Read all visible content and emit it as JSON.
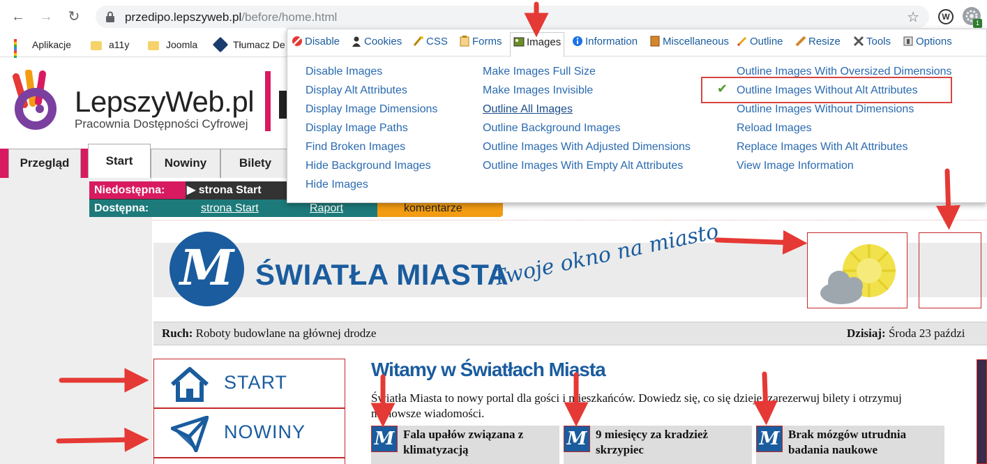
{
  "browser": {
    "url_host": "przedipo.lepszyweb.pl",
    "url_path": "/before/home.html",
    "extension_badge": "1",
    "extension_letter": "W"
  },
  "bookmarks": [
    {
      "label": "Aplikacje",
      "icon": "apps-grid-icon"
    },
    {
      "label": "a11y",
      "icon": "folder-icon"
    },
    {
      "label": "Joomla",
      "icon": "folder-icon"
    },
    {
      "label": "Tłumacz De",
      "icon": "translator-icon"
    }
  ],
  "webdev": {
    "tabs": [
      {
        "label": "Disable",
        "icon": "disable-icon"
      },
      {
        "label": "Cookies",
        "icon": "cookies-icon"
      },
      {
        "label": "CSS",
        "icon": "css-icon"
      },
      {
        "label": "Forms",
        "icon": "forms-icon"
      },
      {
        "label": "Images",
        "icon": "images-icon",
        "active": true
      },
      {
        "label": "Information",
        "icon": "information-icon"
      },
      {
        "label": "Miscellaneous",
        "icon": "miscellaneous-icon"
      },
      {
        "label": "Outline",
        "icon": "outline-icon"
      },
      {
        "label": "Resize",
        "icon": "resize-icon"
      },
      {
        "label": "Tools",
        "icon": "tools-icon"
      },
      {
        "label": "Options",
        "icon": "options-icon"
      }
    ],
    "col1": [
      "Disable Images",
      "Display Alt Attributes",
      "Display Image Dimensions",
      "Display Image Paths",
      "Find Broken Images",
      "Hide Background Images",
      "Hide Images"
    ],
    "col2": [
      "Make Images Full Size",
      "Make Images Invisible",
      "Outline All Images",
      "Outline Background Images",
      "Outline Images With Adjusted Dimensions",
      "Outline Images With Empty Alt Attributes"
    ],
    "col3": [
      "Outline Images With Oversized Dimensions",
      "Outline Images Without Alt Attributes",
      "Outline Images Without Dimensions",
      "Reload Images",
      "Replace Images With Alt Attributes",
      "View Image Information"
    ],
    "checked_item": "Outline Images Without Alt Attributes"
  },
  "site": {
    "logo_title": "LepszyWeb.pl",
    "logo_subtitle": "Pracownia Dostępności Cyfrowej",
    "tabs": [
      "Przegląd",
      "Start",
      "Nowiny",
      "Bilety"
    ],
    "active_tab": "Start",
    "status": {
      "unavailable_label": "Niedostępna:",
      "unavailable_value": "strona Start",
      "available_label": "Dostępna:",
      "available_link": "strona Start",
      "report_link": "Raport",
      "comments": "komentarze"
    },
    "banner": {
      "logo_letter": "M",
      "title": "ŚWIATŁA MIASTA",
      "slogan": "Twoje okno na miasto"
    },
    "ticker": {
      "traffic_label": "Ruch:",
      "traffic_text": "Roboty budowlane na głównej drodze",
      "today_label": "Dzisiaj:",
      "today_text": "Środa 23 paździ"
    },
    "nav": [
      {
        "label": "START",
        "icon": "home-icon"
      },
      {
        "label": "NOWINY",
        "icon": "paper-plane-icon"
      }
    ],
    "main_heading": "Witamy w Światłach Miasta",
    "main_text": "Światła Miasta to nowy portal dla gości i mieszkańców. Dowiedz się, co się dzieje, zarezerwuj bilety i otrzymuj najnowsze wiadomości.",
    "news": [
      {
        "title": "Fala upałów związana z klimatyzacją"
      },
      {
        "title": "9 miesięcy za kradzież skrzypiec"
      },
      {
        "title": "Brak mózgów utrudnia badania naukowe"
      }
    ]
  },
  "colors": {
    "brand_blue": "#1a5c9e",
    "brand_pink": "#d81b60",
    "annotation_red": "#e53935",
    "status_teal": "#1d7a7a"
  }
}
